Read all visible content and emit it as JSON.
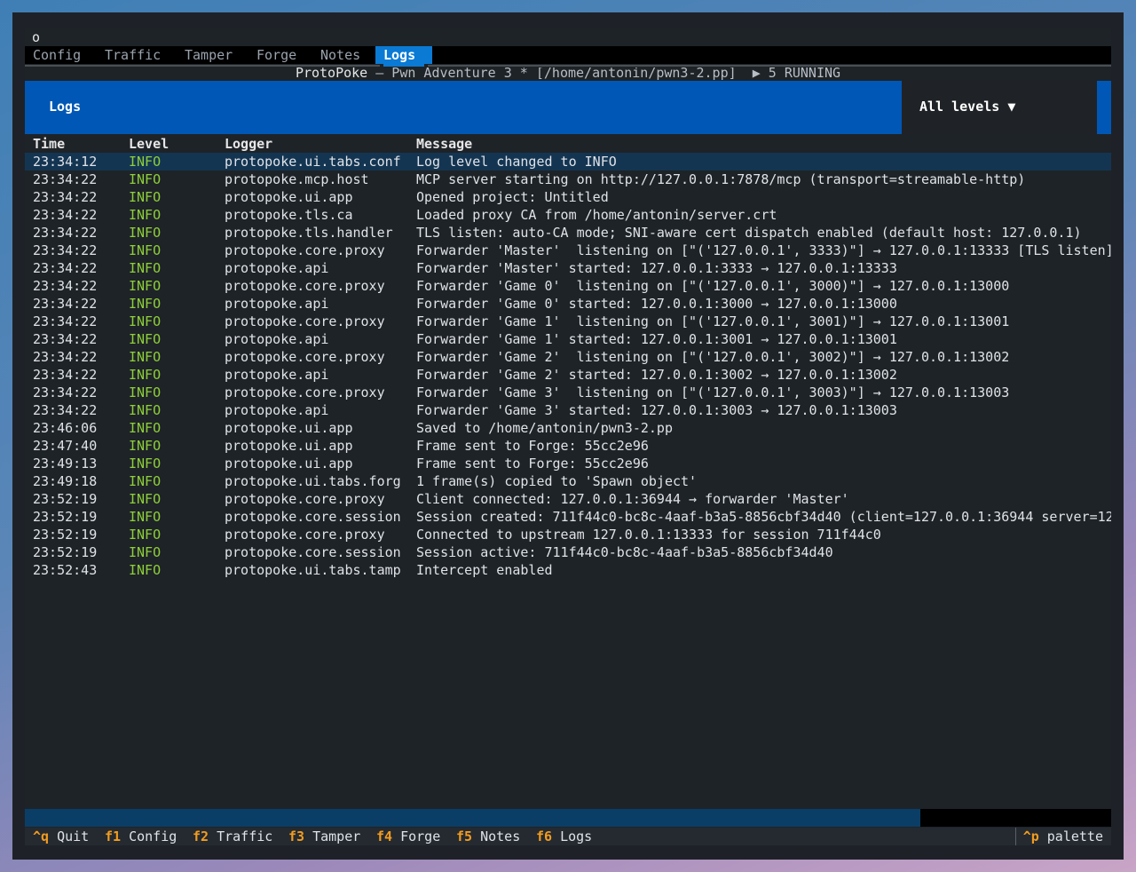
{
  "window": {
    "title_app": "ProtoPoke",
    "title_rest": " — Pwn Adventure 3 * [/home/antonin/pwn3-2.pp]  ▶ 5 RUNNING",
    "dot": "o"
  },
  "tabs": [
    {
      "label": "Config"
    },
    {
      "label": "Traffic"
    },
    {
      "label": "Tamper"
    },
    {
      "label": "Forge"
    },
    {
      "label": "Notes"
    },
    {
      "label": "Logs"
    }
  ],
  "header": {
    "title": "Logs",
    "level_select": "All levels ▼"
  },
  "columns": {
    "time": "Time",
    "level": "Level",
    "logger": "Logger",
    "message": "Message"
  },
  "rows": [
    {
      "time": "23:34:12",
      "level": "INFO",
      "logger": "protopoke.ui.tabs.conf",
      "message": "Log level changed to INFO"
    },
    {
      "time": "23:34:22",
      "level": "INFO",
      "logger": "protopoke.mcp.host",
      "message": "MCP server starting on http://127.0.0.1:7878/mcp (transport=streamable-http)"
    },
    {
      "time": "23:34:22",
      "level": "INFO",
      "logger": "protopoke.ui.app",
      "message": "Opened project: Untitled"
    },
    {
      "time": "23:34:22",
      "level": "INFO",
      "logger": "protopoke.tls.ca",
      "message": "Loaded proxy CA from /home/antonin/server.crt"
    },
    {
      "time": "23:34:22",
      "level": "INFO",
      "logger": "protopoke.tls.handler",
      "message": "TLS listen: auto-CA mode; SNI-aware cert dispatch enabled (default host: 127.0.0.1)"
    },
    {
      "time": "23:34:22",
      "level": "INFO",
      "logger": "protopoke.core.proxy",
      "message": "Forwarder 'Master'  listening on [\"('127.0.0.1', 3333)\"] → 127.0.0.1:13333 [TLS listen]"
    },
    {
      "time": "23:34:22",
      "level": "INFO",
      "logger": "protopoke.api",
      "message": "Forwarder 'Master' started: 127.0.0.1:3333 → 127.0.0.1:13333"
    },
    {
      "time": "23:34:22",
      "level": "INFO",
      "logger": "protopoke.core.proxy",
      "message": "Forwarder 'Game 0'  listening on [\"('127.0.0.1', 3000)\"] → 127.0.0.1:13000"
    },
    {
      "time": "23:34:22",
      "level": "INFO",
      "logger": "protopoke.api",
      "message": "Forwarder 'Game 0' started: 127.0.0.1:3000 → 127.0.0.1:13000"
    },
    {
      "time": "23:34:22",
      "level": "INFO",
      "logger": "protopoke.core.proxy",
      "message": "Forwarder 'Game 1'  listening on [\"('127.0.0.1', 3001)\"] → 127.0.0.1:13001"
    },
    {
      "time": "23:34:22",
      "level": "INFO",
      "logger": "protopoke.api",
      "message": "Forwarder 'Game 1' started: 127.0.0.1:3001 → 127.0.0.1:13001"
    },
    {
      "time": "23:34:22",
      "level": "INFO",
      "logger": "protopoke.core.proxy",
      "message": "Forwarder 'Game 2'  listening on [\"('127.0.0.1', 3002)\"] → 127.0.0.1:13002"
    },
    {
      "time": "23:34:22",
      "level": "INFO",
      "logger": "protopoke.api",
      "message": "Forwarder 'Game 2' started: 127.0.0.1:3002 → 127.0.0.1:13002"
    },
    {
      "time": "23:34:22",
      "level": "INFO",
      "logger": "protopoke.core.proxy",
      "message": "Forwarder 'Game 3'  listening on [\"('127.0.0.1', 3003)\"] → 127.0.0.1:13003"
    },
    {
      "time": "23:34:22",
      "level": "INFO",
      "logger": "protopoke.api",
      "message": "Forwarder 'Game 3' started: 127.0.0.1:3003 → 127.0.0.1:13003"
    },
    {
      "time": "23:46:06",
      "level": "INFO",
      "logger": "protopoke.ui.app",
      "message": "Saved to /home/antonin/pwn3-2.pp"
    },
    {
      "time": "23:47:40",
      "level": "INFO",
      "logger": "protopoke.ui.app",
      "message": "Frame sent to Forge: 55cc2e96"
    },
    {
      "time": "23:49:13",
      "level": "INFO",
      "logger": "protopoke.ui.app",
      "message": "Frame sent to Forge: 55cc2e96"
    },
    {
      "time": "23:49:18",
      "level": "INFO",
      "logger": "protopoke.ui.tabs.forg",
      "message": "1 frame(s) copied to 'Spawn object'"
    },
    {
      "time": "23:52:19",
      "level": "INFO",
      "logger": "protopoke.core.proxy",
      "message": "Client connected: 127.0.0.1:36944 → forwarder 'Master'"
    },
    {
      "time": "23:52:19",
      "level": "INFO",
      "logger": "protopoke.core.session",
      "message": "Session created: 711f44c0-bc8c-4aaf-b3a5-8856cbf34d40 (client=127.0.0.1:36944 server=12"
    },
    {
      "time": "23:52:19",
      "level": "INFO",
      "logger": "protopoke.core.proxy",
      "message": "Connected to upstream 127.0.0.1:13333 for session 711f44c0"
    },
    {
      "time": "23:52:19",
      "level": "INFO",
      "logger": "protopoke.core.session",
      "message": "Session active: 711f44c0-bc8c-4aaf-b3a5-8856cbf34d40"
    },
    {
      "time": "23:52:43",
      "level": "INFO",
      "logger": "protopoke.ui.tabs.tamp",
      "message": "Intercept enabled"
    }
  ],
  "footer": {
    "keys": [
      {
        "key": "^q",
        "label": "Quit"
      },
      {
        "key": "f1",
        "label": "Config"
      },
      {
        "key": "f2",
        "label": "Traffic"
      },
      {
        "key": "f3",
        "label": "Tamper"
      },
      {
        "key": "f4",
        "label": "Forge"
      },
      {
        "key": "f5",
        "label": "Notes"
      },
      {
        "key": "f6",
        "label": "Logs"
      }
    ],
    "palette_key": "^p",
    "palette_label": "palette"
  },
  "colors": {
    "accent": "#0a7ad4",
    "header_bg": "#0057b5",
    "level_info": "#8ecf3a",
    "key_highlight": "#f39c1f",
    "selected_row": "#143552"
  }
}
